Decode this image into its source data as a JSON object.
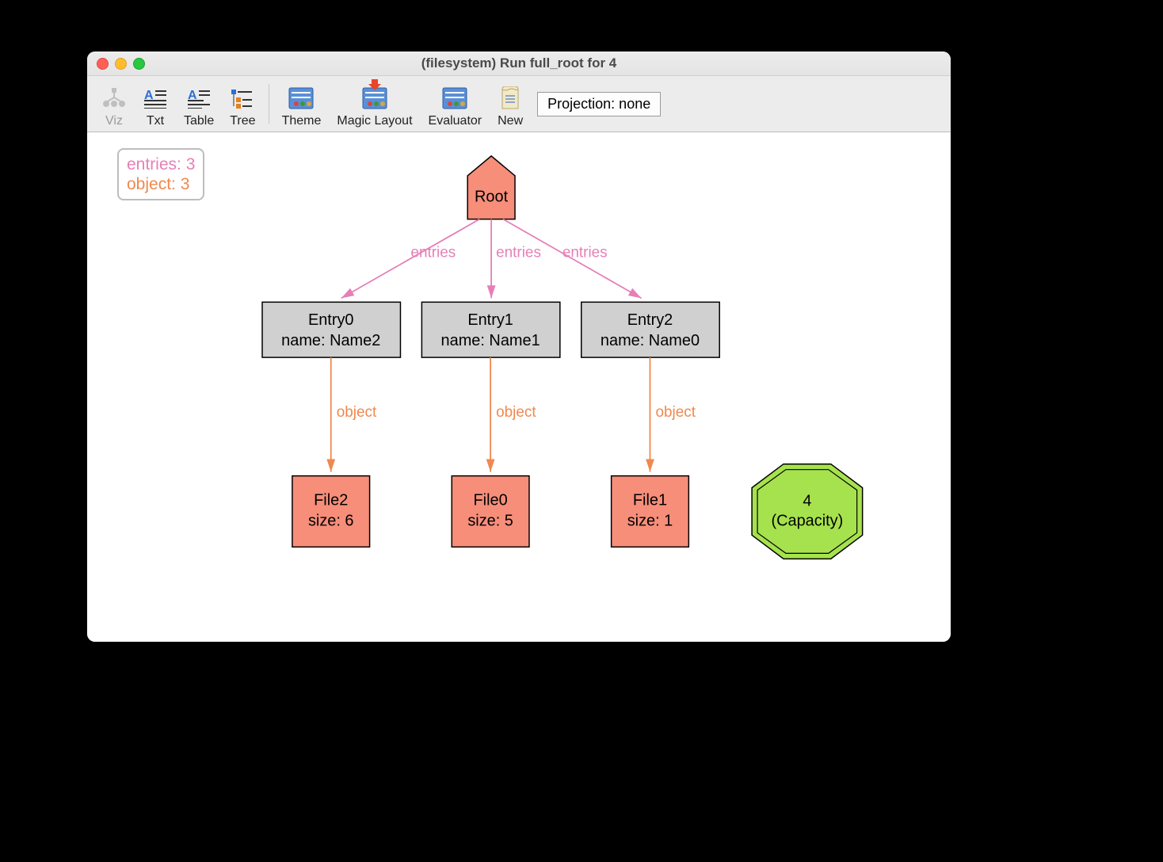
{
  "window": {
    "title": "(filesystem) Run full_root for 4"
  },
  "toolbar": {
    "viz": "Viz",
    "txt": "Txt",
    "table": "Table",
    "tree": "Tree",
    "theme": "Theme",
    "magic": "Magic Layout",
    "evaluator": "Evaluator",
    "new": "New",
    "projection": "Projection: none"
  },
  "legend": {
    "line1": "entries: 3",
    "line2": "object: 3"
  },
  "graph": {
    "root": {
      "label": "Root"
    },
    "edge_entries_label": "entries",
    "edge_object_label": "object",
    "entries": [
      {
        "id": "Entry0",
        "name_line": "name: Name2"
      },
      {
        "id": "Entry1",
        "name_line": "name: Name1"
      },
      {
        "id": "Entry2",
        "name_line": "name: Name0"
      }
    ],
    "files": [
      {
        "id": "File2",
        "size_line": "size: 6"
      },
      {
        "id": "File0",
        "size_line": "size: 5"
      },
      {
        "id": "File1",
        "size_line": "size: 1"
      }
    ],
    "capacity": {
      "value": "4",
      "label": "(Capacity)"
    }
  }
}
